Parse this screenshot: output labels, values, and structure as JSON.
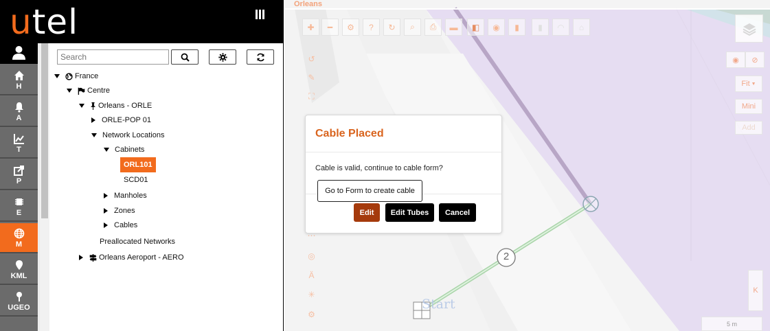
{
  "brand": {
    "logo_part1": "u",
    "logo_part2": "tel",
    "accent": "#f26b1d"
  },
  "nav": {
    "items": [
      {
        "label": "H",
        "icon": "home-icon"
      },
      {
        "label": "A",
        "icon": "bell-icon"
      },
      {
        "label": "T",
        "icon": "chart-line-icon"
      },
      {
        "label": "P",
        "icon": "share-icon"
      },
      {
        "label": "E",
        "icon": "chip-icon"
      },
      {
        "label": "M",
        "icon": "globe-icon",
        "active": true
      },
      {
        "label": "KML",
        "icon": "map-marker-icon"
      },
      {
        "label": "UGEO",
        "icon": "pin-icon"
      }
    ]
  },
  "search": {
    "placeholder": "Search"
  },
  "tree": {
    "france": "France",
    "centre": "Centre",
    "orleans": "Orleans - ORLE",
    "orle_pop": "ORLE-POP 01",
    "network_locations": "Network Locations",
    "cabinets": "Cabinets",
    "orl101": "ORL101",
    "scd01": "SCD01",
    "manholes": "Manholes",
    "zones": "Zones",
    "cables": "Cables",
    "preallocated": "Preallocated Networks",
    "aeroport": "Orleans Aeroport - AERO"
  },
  "map": {
    "title": "Orleans",
    "start_label": "Start",
    "node_label": "2",
    "scale": "5 m",
    "fit_label": "Fit",
    "mini_label": "Mini",
    "add_label": "Add",
    "k_label": "K"
  },
  "modal": {
    "title": "Cable Placed",
    "message": "Cable is valid, continue to cable form?",
    "tooltip": "Go to Form to create cable",
    "edit": "Edit",
    "edit_tubes": "Edit Tubes",
    "cancel": "Cancel",
    "edit_color": "#a53a0c",
    "dark_color": "#000000"
  }
}
